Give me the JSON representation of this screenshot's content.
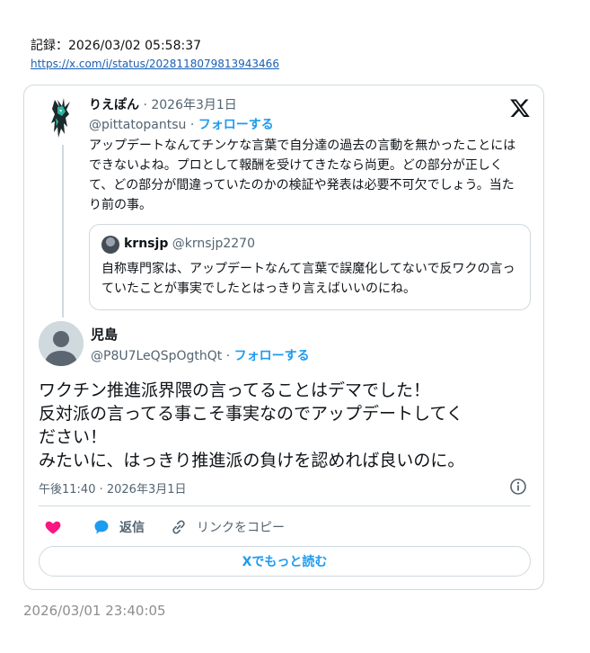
{
  "record": {
    "line": "記録：2026/03/02 05:58:37",
    "url": "https://x.com/i/status/2028118079813943466"
  },
  "parent_tweet": {
    "name": "りえぽん",
    "date": "· 2026年3月1日",
    "handle": "@pittatopantsu",
    "sep": "·",
    "follow": "フォローする",
    "text": "アップデートなんてチンケな言葉で自分達の過去の言動を無かったことにはできないよね。プロとして報酬を受けてきたなら尚更。どの部分が正しくて、どの部分が間違っていたのかの検証や発表は必要不可欠でしょう。当たり前の事。"
  },
  "quote": {
    "name": "krnsjp",
    "handle": "@krnsjp2270",
    "text": "自称専門家は、アップデートなんて言葉で誤魔化してないで反ワクの言っていたことが事実でしたとはっきり言えばいいのにね。"
  },
  "main_tweet": {
    "name": "児島",
    "handle": "@P8U7LeQSpOgthQt",
    "sep": "·",
    "follow": "フォローする",
    "text_lines": [
      "ワクチン推進派界隈の言ってることはデマでした！",
      "反対派の言ってる事こそ事実なのでアップデートしてく",
      "ださい！",
      "みたいに、はっきり推進派の負けを認めれば良いのに。"
    ],
    "timestamp": "午後11:40 · 2026年3月1日"
  },
  "actions": {
    "reply_label": "返信",
    "copy_link_label": "リンクをコピー",
    "read_more_label": "Xでもっと読む"
  },
  "bottom_stamp": "2026/03/01 23:40:05",
  "colors": {
    "accent": "#1d9bf0",
    "heart": "#f91880",
    "muted": "#536471",
    "border": "#cfd9de"
  },
  "icons": [
    "x-logo-icon",
    "heart-icon",
    "reply-bubble-icon",
    "link-icon",
    "info-icon"
  ]
}
